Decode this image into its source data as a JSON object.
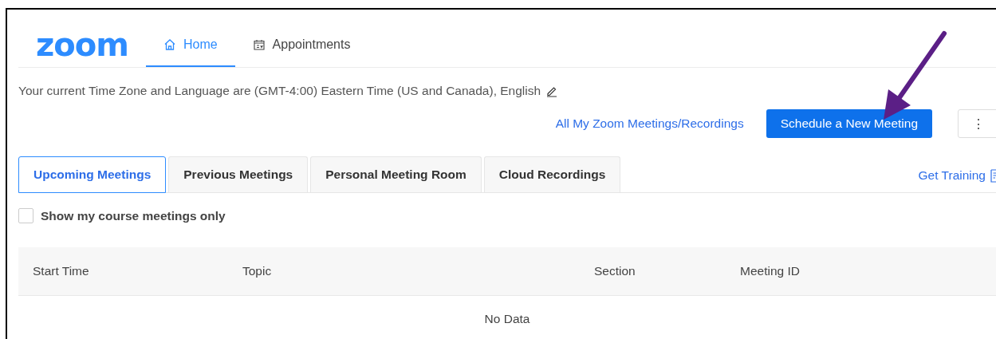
{
  "logo": "zoom",
  "nav": [
    {
      "label": "Home",
      "kind": "home",
      "selected": true
    },
    {
      "label": "Appointments",
      "kind": "calendar",
      "selected": false
    }
  ],
  "timezone_text": "Your current Time Zone and Language are (GMT-4:00) Eastern Time (US and Canada), English",
  "all_meetings_link": "All My Zoom Meetings/Recordings",
  "schedule_button": "Schedule a New Meeting",
  "more_button": "⋮",
  "tabs": [
    {
      "label": "Upcoming Meetings",
      "selected": true
    },
    {
      "label": "Previous Meetings",
      "selected": false
    },
    {
      "label": "Personal Meeting Room",
      "selected": false
    },
    {
      "label": "Cloud Recordings",
      "selected": false
    }
  ],
  "get_training": "Get Training",
  "course_filter": {
    "label": "Show my course meetings only",
    "checked": false
  },
  "table": {
    "columns": [
      "Start Time",
      "Topic",
      "Section",
      "Meeting ID"
    ],
    "empty_text": "No Data"
  }
}
